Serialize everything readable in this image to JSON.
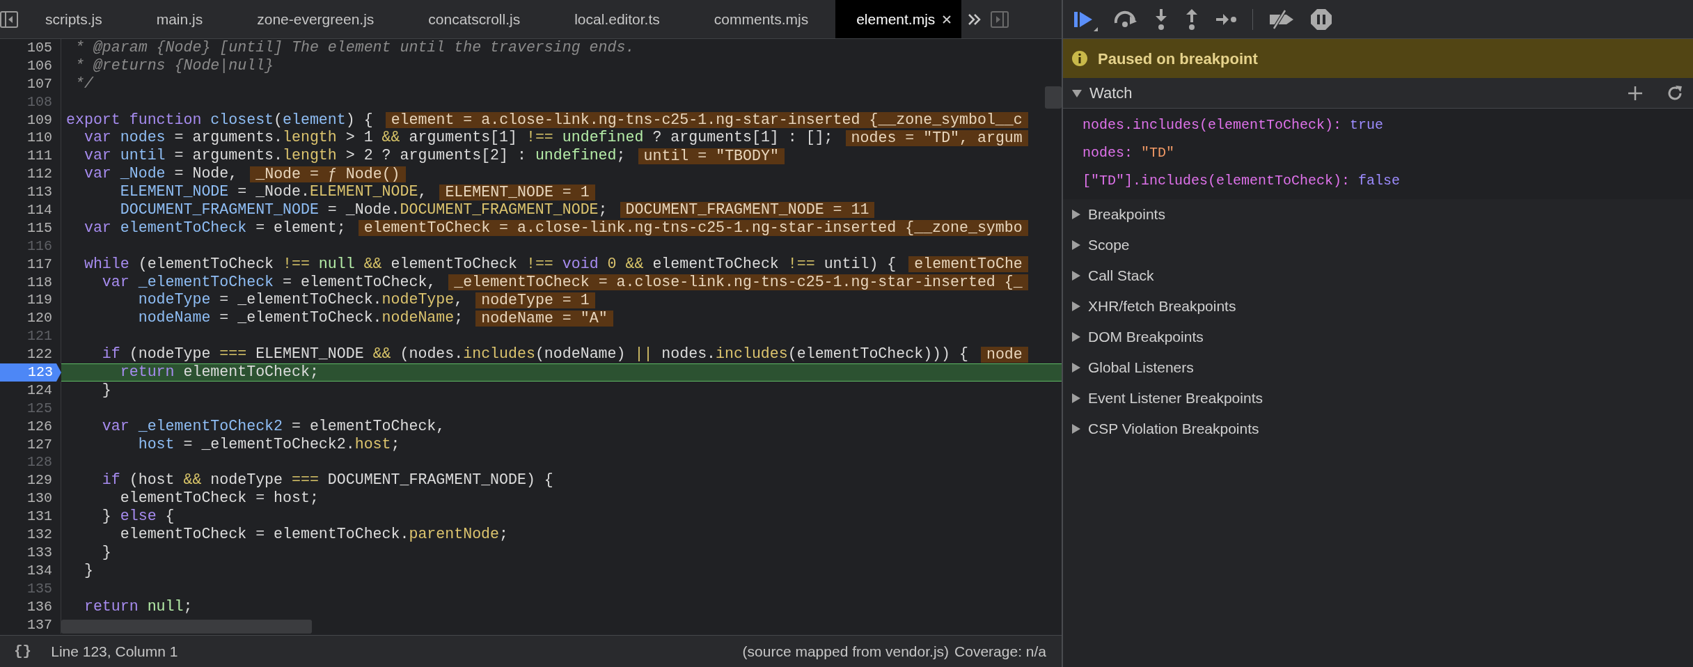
{
  "editor_tabs": [
    {
      "label": "scripts.js",
      "selected": false
    },
    {
      "label": "main.js",
      "selected": false
    },
    {
      "label": "zone-evergreen.js",
      "selected": false
    },
    {
      "label": "concatscroll.js",
      "selected": false
    },
    {
      "label": "local.editor.ts",
      "selected": false
    },
    {
      "label": "comments.mjs",
      "selected": false
    },
    {
      "label": "element.mjs",
      "selected": true
    }
  ],
  "code": {
    "lines": [
      {
        "number": "105",
        "dimmed": false,
        "breakpoint": false,
        "current": false,
        "tokens": [
          {
            "kind": "comment",
            "text": " * @param {Node} [until] The element until the traversing ends."
          }
        ]
      },
      {
        "number": "106",
        "dimmed": false,
        "breakpoint": false,
        "current": false,
        "tokens": [
          {
            "kind": "comment",
            "text": " * @returns {Node|null}"
          }
        ]
      },
      {
        "number": "107",
        "dimmed": false,
        "breakpoint": false,
        "current": false,
        "tokens": [
          {
            "kind": "comment",
            "text": " */"
          }
        ]
      },
      {
        "number": "108",
        "dimmed": true,
        "breakpoint": false,
        "current": false
      },
      {
        "number": "109",
        "dimmed": false,
        "breakpoint": false,
        "current": false,
        "tokens": [
          {
            "kind": "keyword",
            "text": "export function "
          },
          {
            "kind": "variable",
            "text": "closest"
          },
          {
            "kind": "plain",
            "text": "("
          },
          {
            "kind": "variable",
            "text": "element"
          },
          {
            "kind": "plain",
            "text": ") {"
          }
        ],
        "inline_value": "element = a.close-link.ng-tns-c25-1.ng-star-inserted {__zone_symbol__c"
      },
      {
        "number": "110",
        "dimmed": false,
        "breakpoint": false,
        "current": false,
        "tokens": [
          {
            "kind": "keyword",
            "text": "  var "
          },
          {
            "kind": "variable",
            "text": "nodes"
          },
          {
            "kind": "plain",
            "text": " = arguments."
          },
          {
            "kind": "property",
            "text": "length"
          },
          {
            "kind": "plain",
            "text": " > 1 "
          },
          {
            "kind": "operator",
            "text": "&&"
          },
          {
            "kind": "plain",
            "text": " arguments[1] "
          },
          {
            "kind": "operator",
            "text": "!=="
          },
          {
            "kind": "atom",
            "text": " undefined"
          },
          {
            "kind": "plain",
            "text": " ? arguments[1] : [];"
          }
        ],
        "inline_value": "nodes = \"TD\", argum"
      },
      {
        "number": "111",
        "dimmed": false,
        "breakpoint": false,
        "current": false,
        "tokens": [
          {
            "kind": "keyword",
            "text": "  var "
          },
          {
            "kind": "variable",
            "text": "until"
          },
          {
            "kind": "plain",
            "text": " = arguments."
          },
          {
            "kind": "property",
            "text": "length"
          },
          {
            "kind": "plain",
            "text": " > 2 ? arguments[2] : "
          },
          {
            "kind": "atom",
            "text": "undefined"
          },
          {
            "kind": "plain",
            "text": ";"
          }
        ],
        "inline_value": "until = \"TBODY\""
      },
      {
        "number": "112",
        "dimmed": false,
        "breakpoint": false,
        "current": false,
        "tokens": [
          {
            "kind": "keyword",
            "text": "  var "
          },
          {
            "kind": "variable",
            "text": "_Node"
          },
          {
            "kind": "plain",
            "text": " = Node,"
          }
        ],
        "inline_value": "_Node = ƒ Node()"
      },
      {
        "number": "113",
        "dimmed": false,
        "breakpoint": false,
        "current": false,
        "tokens": [
          {
            "kind": "variable",
            "text": "      ELEMENT_NODE"
          },
          {
            "kind": "plain",
            "text": " = _Node."
          },
          {
            "kind": "property",
            "text": "ELEMENT_NODE"
          },
          {
            "kind": "plain",
            "text": ","
          }
        ],
        "inline_value": "ELEMENT_NODE = 1"
      },
      {
        "number": "114",
        "dimmed": false,
        "breakpoint": false,
        "current": false,
        "tokens": [
          {
            "kind": "variable",
            "text": "      DOCUMENT_FRAGMENT_NODE"
          },
          {
            "kind": "plain",
            "text": " = _Node."
          },
          {
            "kind": "property",
            "text": "DOCUMENT_FRAGMENT_NODE"
          },
          {
            "kind": "plain",
            "text": ";"
          }
        ],
        "inline_value": "DOCUMENT_FRAGMENT_NODE = 11"
      },
      {
        "number": "115",
        "dimmed": false,
        "breakpoint": false,
        "current": false,
        "tokens": [
          {
            "kind": "keyword",
            "text": "  var "
          },
          {
            "kind": "variable",
            "text": "elementToCheck"
          },
          {
            "kind": "plain",
            "text": " = element;"
          }
        ],
        "inline_value": "elementToCheck = a.close-link.ng-tns-c25-1.ng-star-inserted {__zone_symbo"
      },
      {
        "number": "116",
        "dimmed": true,
        "breakpoint": false,
        "current": false
      },
      {
        "number": "117",
        "dimmed": false,
        "breakpoint": false,
        "current": false,
        "tokens": [
          {
            "kind": "keyword",
            "text": "  while"
          },
          {
            "kind": "plain",
            "text": " (elementToCheck "
          },
          {
            "kind": "operator",
            "text": "!=="
          },
          {
            "kind": "atom",
            "text": " null"
          },
          {
            "kind": "operator",
            "text": " &&"
          },
          {
            "kind": "plain",
            "text": " elementToCheck "
          },
          {
            "kind": "operator",
            "text": "!=="
          },
          {
            "kind": "keyword",
            "text": " void"
          },
          {
            "kind": "number",
            "text": " 0"
          },
          {
            "kind": "operator",
            "text": " &&"
          },
          {
            "kind": "plain",
            "text": " elementToCheck "
          },
          {
            "kind": "operator",
            "text": "!=="
          },
          {
            "kind": "plain",
            "text": " until) {"
          }
        ],
        "inline_value": "elementToChe"
      },
      {
        "number": "118",
        "dimmed": false,
        "breakpoint": false,
        "current": false,
        "tokens": [
          {
            "kind": "keyword",
            "text": "    var "
          },
          {
            "kind": "variable",
            "text": "_elementToCheck"
          },
          {
            "kind": "plain",
            "text": " = elementToCheck,"
          }
        ],
        "inline_value": "_elementToCheck = a.close-link.ng-tns-c25-1.ng-star-inserted {_"
      },
      {
        "number": "119",
        "dimmed": false,
        "breakpoint": false,
        "current": false,
        "tokens": [
          {
            "kind": "variable",
            "text": "        nodeType"
          },
          {
            "kind": "plain",
            "text": " = _elementToCheck."
          },
          {
            "kind": "property",
            "text": "nodeType"
          },
          {
            "kind": "plain",
            "text": ","
          }
        ],
        "inline_value": "nodeType = 1"
      },
      {
        "number": "120",
        "dimmed": false,
        "breakpoint": false,
        "current": false,
        "tokens": [
          {
            "kind": "variable",
            "text": "        nodeName"
          },
          {
            "kind": "plain",
            "text": " = _elementToCheck."
          },
          {
            "kind": "property",
            "text": "nodeName"
          },
          {
            "kind": "plain",
            "text": ";"
          }
        ],
        "inline_value": "nodeName = \"A\""
      },
      {
        "number": "121",
        "dimmed": true,
        "breakpoint": false,
        "current": false
      },
      {
        "number": "122",
        "dimmed": false,
        "breakpoint": false,
        "current": false,
        "tokens": [
          {
            "kind": "keyword",
            "text": "    if"
          },
          {
            "kind": "plain",
            "text": " (nodeType "
          },
          {
            "kind": "operator",
            "text": "==="
          },
          {
            "kind": "plain",
            "text": " ELEMENT_NODE "
          },
          {
            "kind": "operator",
            "text": "&&"
          },
          {
            "kind": "plain",
            "text": " (nodes."
          },
          {
            "kind": "property",
            "text": "includes"
          },
          {
            "kind": "plain",
            "text": "(nodeName) "
          },
          {
            "kind": "operator",
            "text": "||"
          },
          {
            "kind": "plain",
            "text": " nodes."
          },
          {
            "kind": "property",
            "text": "includes"
          },
          {
            "kind": "plain",
            "text": "(elementToCheck))) {"
          }
        ],
        "inline_value": "node"
      },
      {
        "number": "123",
        "dimmed": false,
        "breakpoint": true,
        "current": true,
        "tokens": [
          {
            "kind": "keyword",
            "text": "      return"
          },
          {
            "kind": "plain",
            "text": " elementToCheck;"
          }
        ]
      },
      {
        "number": "124",
        "dimmed": false,
        "breakpoint": false,
        "current": false,
        "tokens": [
          {
            "kind": "plain",
            "text": "    }"
          }
        ]
      },
      {
        "number": "125",
        "dimmed": true,
        "breakpoint": false,
        "current": false
      },
      {
        "number": "126",
        "dimmed": false,
        "breakpoint": false,
        "current": false,
        "tokens": [
          {
            "kind": "keyword",
            "text": "    var "
          },
          {
            "kind": "variable",
            "text": "_elementToCheck2"
          },
          {
            "kind": "plain",
            "text": " = elementToCheck,"
          }
        ]
      },
      {
        "number": "127",
        "dimmed": false,
        "breakpoint": false,
        "current": false,
        "tokens": [
          {
            "kind": "variable",
            "text": "        host"
          },
          {
            "kind": "plain",
            "text": " = _elementToCheck2."
          },
          {
            "kind": "property",
            "text": "host"
          },
          {
            "kind": "plain",
            "text": ";"
          }
        ]
      },
      {
        "number": "128",
        "dimmed": true,
        "breakpoint": false,
        "current": false
      },
      {
        "number": "129",
        "dimmed": false,
        "breakpoint": false,
        "current": false,
        "tokens": [
          {
            "kind": "keyword",
            "text": "    if"
          },
          {
            "kind": "plain",
            "text": " (host "
          },
          {
            "kind": "operator",
            "text": "&&"
          },
          {
            "kind": "plain",
            "text": " nodeType "
          },
          {
            "kind": "operator",
            "text": "==="
          },
          {
            "kind": "plain",
            "text": " DOCUMENT_FRAGMENT_NODE) {"
          }
        ]
      },
      {
        "number": "130",
        "dimmed": false,
        "breakpoint": false,
        "current": false,
        "tokens": [
          {
            "kind": "plain",
            "text": "      elementToCheck = host;"
          }
        ]
      },
      {
        "number": "131",
        "dimmed": false,
        "breakpoint": false,
        "current": false,
        "tokens": [
          {
            "kind": "plain",
            "text": "    } "
          },
          {
            "kind": "keyword",
            "text": "else"
          },
          {
            "kind": "plain",
            "text": " {"
          }
        ]
      },
      {
        "number": "132",
        "dimmed": false,
        "breakpoint": false,
        "current": false,
        "tokens": [
          {
            "kind": "plain",
            "text": "      elementToCheck = elementToCheck."
          },
          {
            "kind": "property",
            "text": "parentNode"
          },
          {
            "kind": "plain",
            "text": ";"
          }
        ]
      },
      {
        "number": "133",
        "dimmed": false,
        "breakpoint": false,
        "current": false,
        "tokens": [
          {
            "kind": "plain",
            "text": "    }"
          }
        ]
      },
      {
        "number": "134",
        "dimmed": false,
        "breakpoint": false,
        "current": false,
        "tokens": [
          {
            "kind": "plain",
            "text": "  }"
          }
        ]
      },
      {
        "number": "135",
        "dimmed": true,
        "breakpoint": false,
        "current": false
      },
      {
        "number": "136",
        "dimmed": false,
        "breakpoint": false,
        "current": false,
        "tokens": [
          {
            "kind": "keyword",
            "text": "  return"
          },
          {
            "kind": "atom",
            "text": " null"
          },
          {
            "kind": "plain",
            "text": ";"
          }
        ]
      },
      {
        "number": "137",
        "dimmed": false,
        "breakpoint": false,
        "current": false
      }
    ]
  },
  "status_bar": {
    "pretty_print": "{}",
    "cursor": "Line 123, Column 1",
    "source_prefix": "(source mapped from ",
    "source_link": "vendor.js",
    "source_suffix": ")",
    "coverage": "Coverage: n/a"
  },
  "debugger": {
    "banner": "Paused on breakpoint",
    "watch": {
      "title": "Watch",
      "expanded": true,
      "items": [
        {
          "expression": "nodes.includes(elementToCheck):",
          "value": "true",
          "kind": "boolean"
        },
        {
          "expression": "nodes:",
          "value": "\"TD\"",
          "kind": "string"
        },
        {
          "expression": "[\"TD\"].includes(elementToCheck):",
          "value": "false",
          "kind": "boolean"
        }
      ]
    },
    "sections": [
      {
        "title": "Breakpoints",
        "expanded": false
      },
      {
        "title": "Scope",
        "expanded": false
      },
      {
        "title": "Call Stack",
        "expanded": false
      },
      {
        "title": "XHR/fetch Breakpoints",
        "expanded": false
      },
      {
        "title": "DOM Breakpoints",
        "expanded": false
      },
      {
        "title": "Global Listeners",
        "expanded": false
      },
      {
        "title": "Event Listener Breakpoints",
        "expanded": false
      },
      {
        "title": "CSP Violation Breakpoints",
        "expanded": false
      }
    ]
  }
}
